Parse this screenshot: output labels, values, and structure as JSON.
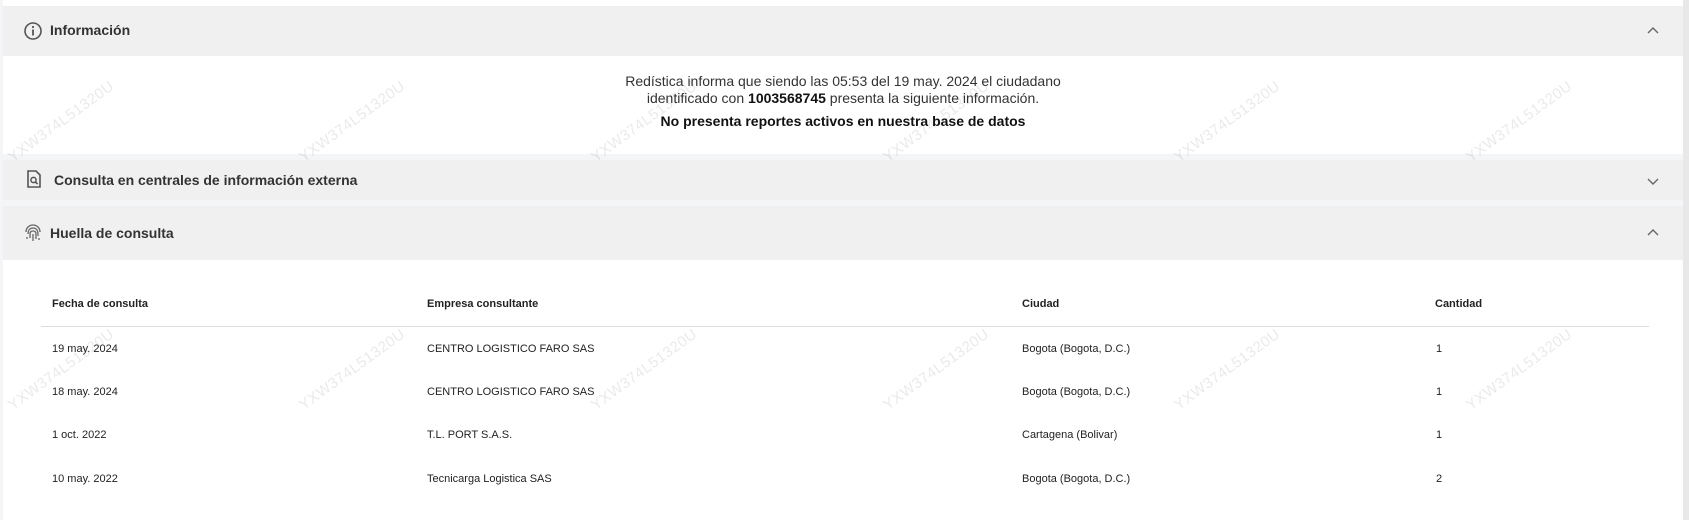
{
  "info_panel": {
    "title": "Información",
    "line1": "Redística informa que siendo las 05:53 del 19 may. 2024 el ciudadano",
    "line2_prefix": "identificado con",
    "line2_id": "1003568745",
    "line2_suffix": "presenta la siguiente información.",
    "status": "No presenta reportes activos en nuestra base de datos"
  },
  "external_panel": {
    "title": "Consulta en centrales de información externa"
  },
  "footprint_panel": {
    "title": "Huella de consulta",
    "headers": [
      "Fecha de consulta",
      "Empresa consultante",
      "Ciudad",
      "Cantidad"
    ],
    "rows": [
      [
        "19 may. 2024",
        "CENTRO LOGISTICO FARO SAS",
        "Bogota (Bogota, D.C.)",
        "1"
      ],
      [
        "18 may. 2024",
        "CENTRO LOGISTICO FARO SAS",
        "Bogota (Bogota, D.C.)",
        "1"
      ],
      [
        "1 oct. 2022",
        "T.L. PORT S.A.S.",
        "Cartagena (Bolivar)",
        "1"
      ],
      [
        "10 may. 2022",
        "Tecnicarga Logistica SAS",
        "Bogota (Bogota, D.C.)",
        "2"
      ]
    ]
  },
  "watermark": "YXW374L51320U",
  "colors": {
    "header_bg": "#f0f0f0",
    "text": "#333333"
  }
}
